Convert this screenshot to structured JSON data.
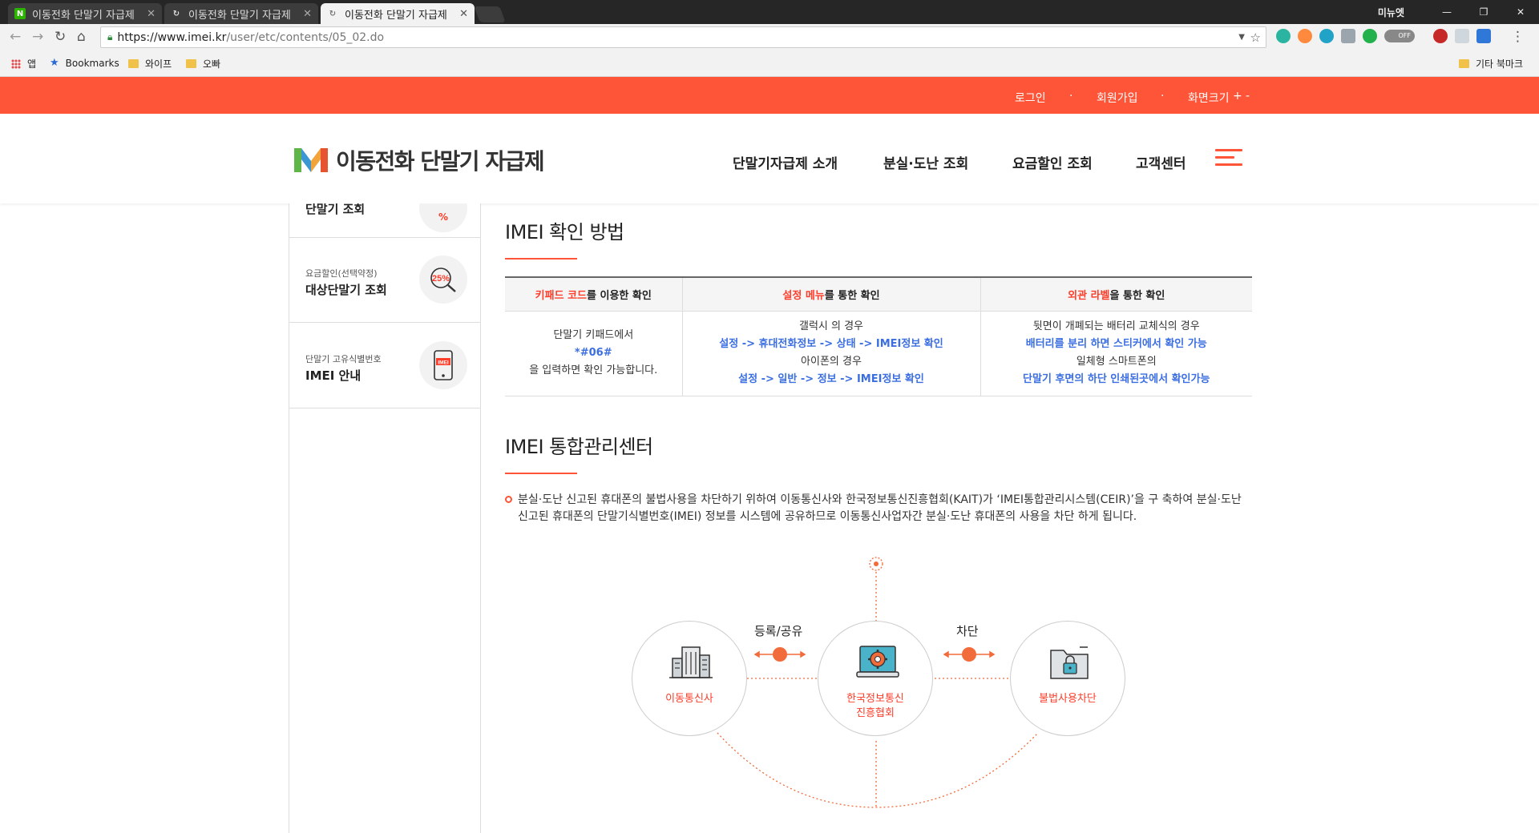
{
  "browser": {
    "tabs": [
      {
        "title": "이동전화 단말기 자급제",
        "favicon": "naver-n-icon"
      },
      {
        "title": "이동전화 단말기 자급제",
        "favicon": "spinner-icon"
      },
      {
        "title": "이동전화 단말기 자급제",
        "favicon": "spinner-icon"
      }
    ],
    "user_label": "미뉴엣",
    "url_host": "https://www.imei.kr",
    "url_path": "/user/etc/contents/05_02.do",
    "toggle_label": "OFF",
    "bookmarks": {
      "apps": "앱",
      "bookmarks": "Bookmarks",
      "wife": "와이프",
      "brother": "오빠",
      "other": "기타 북마크"
    }
  },
  "topbar": {
    "login": "로그인",
    "join": "회원가입",
    "zoom": "화면크기",
    "zoom_plus": "+",
    "zoom_minus": "-",
    "sep": "·"
  },
  "header": {
    "logo_text": "이동전화 단말기 자급제",
    "menu": [
      "단말기자급제 소개",
      "분실·도난 조회",
      "요금할인 조회",
      "고객센터"
    ]
  },
  "sidebar": {
    "items": [
      {
        "small": "",
        "big": "단말기 조회",
        "icon": "phone-search-icon"
      },
      {
        "small": "요금할인(선택약정)",
        "big": "대상단말기 조회",
        "icon_text": "25%",
        "icon": "discount-search-icon"
      },
      {
        "small": "단말기 고유식별번호",
        "big": "IMEI 안내",
        "icon_text": "IMEI",
        "icon": "imei-phone-icon"
      }
    ]
  },
  "section1": {
    "title": "IMEI 확인 방법",
    "table": {
      "headers": [
        {
          "hl": "키패드 코드",
          "rest": "를 이용한 확인"
        },
        {
          "hl": "설정 메뉴",
          "rest": "를 통한 확인"
        },
        {
          "hl": "외관 라벨",
          "rest": "을 통한 확인"
        }
      ],
      "col1": {
        "line1": "단말기 키패드에서",
        "code": "*#06#",
        "line3": "을 입력하면 확인 가능합니다."
      },
      "col2": {
        "galaxy": "갤럭시 의 경우",
        "galaxy_path": "설정 -> 휴대전화정보 -> 상태 -> IMEI정보 확인",
        "iphone": "아이폰의 경우",
        "iphone_path": "설정 -> 일반 -> 정보 -> IMEI정보 확인"
      },
      "col3": {
        "battery": "뒷면이 개폐되는 배터리 교체식의 경우",
        "battery_path": "배터리를 분리 하면 스티커에서 확인 가능",
        "integrated": "일체형 스마트폰의",
        "integrated_path": "단말기 후면의 하단 인쇄된곳에서 확인가능"
      }
    }
  },
  "section2": {
    "title": "IMEI 통합관리센터",
    "desc": "분실·도난 신고된 휴대폰의 불법사용을 차단하기 위하여 이동통신사와 한국정보통신진흥협회(KAIT)가 ‘IMEI통합관리시스템(CEIR)’을 구 축하여 분실·도난 신고된 휴대폰의 단말기식별번호(IMEI) 정보를 시스템에 공유하므로 이동통신사업자간 분실·도난 휴대폰의 사용을 차단 하게 됩니다.",
    "diagram": {
      "label_register": "등록/공유",
      "label_block": "차단",
      "node1": "이동통신사",
      "node2_line1": "한국정보통신",
      "node2_line2": "진흥협회",
      "node3": "불법사용차단"
    }
  },
  "colors": {
    "brand": "#fe5437",
    "link_blue": "#3b6ee0",
    "highlight_red": "#fe3d2a"
  }
}
